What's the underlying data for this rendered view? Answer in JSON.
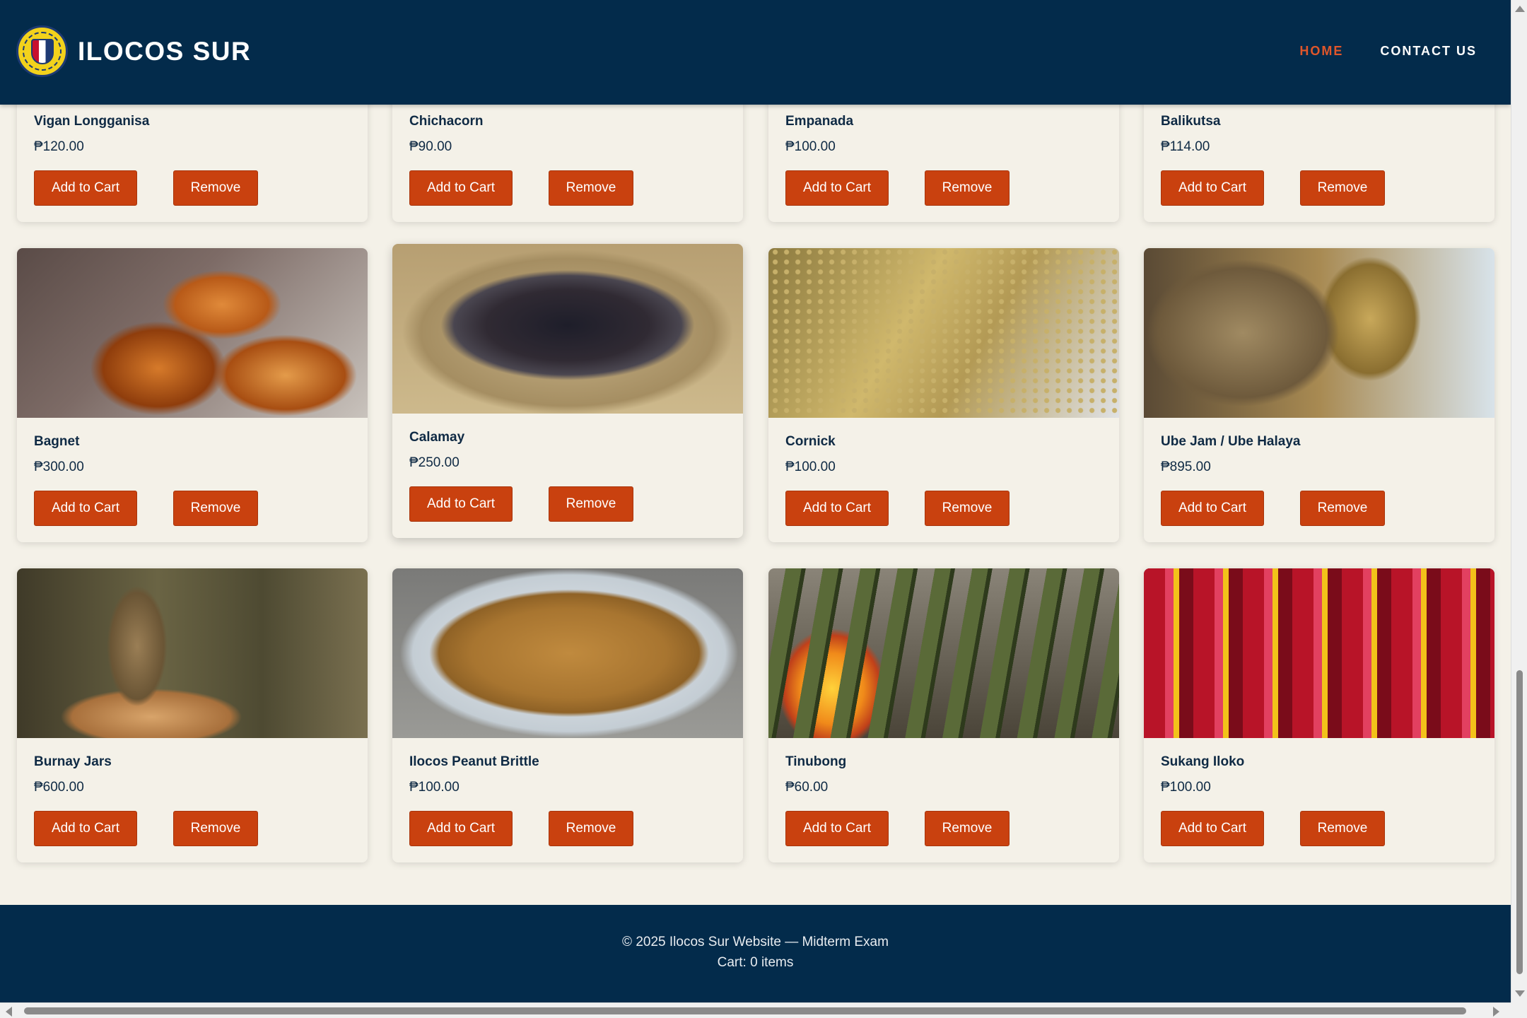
{
  "header": {
    "brand_name": "ILOCOS SUR",
    "logo_icon": "provincial-seal-icon",
    "nav": [
      {
        "label": "HOME",
        "active": true
      },
      {
        "label": "CONTACT US",
        "active": false
      }
    ]
  },
  "products": [
    {
      "name": "Vigan Longganisa",
      "price": "₱120.00",
      "add_label": "Add to Cart",
      "remove_label": "Remove"
    },
    {
      "name": "Chichacorn",
      "price": "₱90.00",
      "add_label": "Add to Cart",
      "remove_label": "Remove"
    },
    {
      "name": "Empanada",
      "price": "₱100.00",
      "add_label": "Add to Cart",
      "remove_label": "Remove"
    },
    {
      "name": "Balikutsa",
      "price": "₱114.00",
      "add_label": "Add to Cart",
      "remove_label": "Remove"
    },
    {
      "name": "Bagnet",
      "price": "₱300.00",
      "add_label": "Add to Cart",
      "remove_label": "Remove"
    },
    {
      "name": "Calamay",
      "price": "₱250.00",
      "add_label": "Add to Cart",
      "remove_label": "Remove"
    },
    {
      "name": "Cornick",
      "price": "₱100.00",
      "add_label": "Add to Cart",
      "remove_label": "Remove"
    },
    {
      "name": "Ube Jam / Ube Halaya",
      "price": "₱895.00",
      "add_label": "Add to Cart",
      "remove_label": "Remove"
    },
    {
      "name": "Burnay Jars",
      "price": "₱600.00",
      "add_label": "Add to Cart",
      "remove_label": "Remove"
    },
    {
      "name": "Ilocos Peanut Brittle",
      "price": "₱100.00",
      "add_label": "Add to Cart",
      "remove_label": "Remove"
    },
    {
      "name": "Tinubong",
      "price": "₱60.00",
      "add_label": "Add to Cart",
      "remove_label": "Remove"
    },
    {
      "name": "Sukang Iloko",
      "price": "₱100.00",
      "add_label": "Add to Cart",
      "remove_label": "Remove"
    }
  ],
  "footer": {
    "copyright": "© 2025 Ilocos Sur Website — Midterm Exam",
    "cart_status": "Cart: 0 items"
  },
  "colors": {
    "header_bg": "#032b4b",
    "accent": "#c9410f",
    "nav_active": "#e0562a",
    "page_bg": "#f4f1e8"
  }
}
